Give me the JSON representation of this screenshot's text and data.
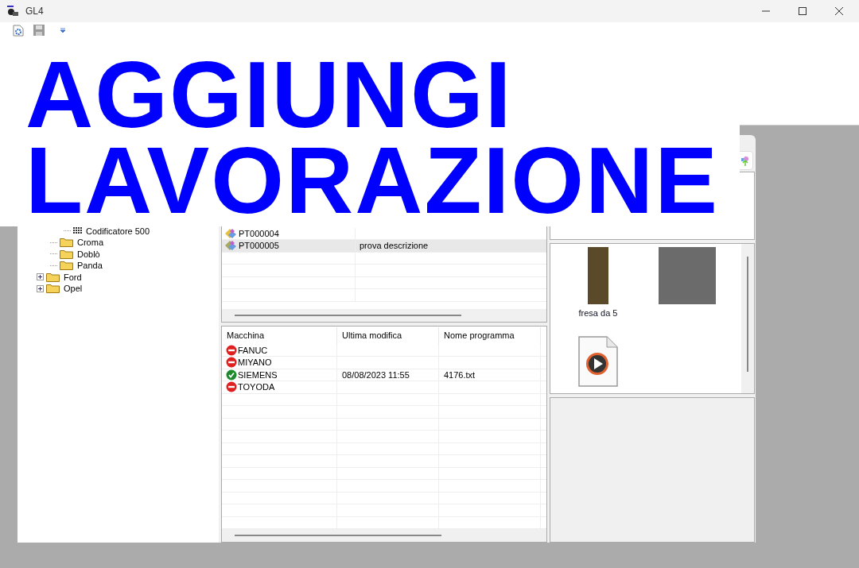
{
  "window": {
    "title": "GL4"
  },
  "banner": {
    "lines": [
      "AGGIUNGI",
      "LAVORAZIONE"
    ]
  },
  "tree": [
    {
      "children": [
        {
          "children": [
            {
              "label": "Codificatore 500",
              "kind": "encoder"
            }
          ]
        },
        {
          "label": "Croma",
          "kind": "folder"
        },
        {
          "label": "Doblò",
          "kind": "folder"
        },
        {
          "label": "Panda",
          "kind": "folder"
        }
      ]
    },
    {
      "label": "Ford",
      "kind": "folder",
      "expanded": false
    },
    {
      "label": "Opel",
      "kind": "folder",
      "expanded": false
    }
  ],
  "processes": {
    "rows": [
      {
        "code": "PT000004",
        "description": "",
        "selected": false
      },
      {
        "code": "PT000005",
        "description": "prova descrizione",
        "selected": true
      }
    ]
  },
  "machines": {
    "columns": [
      "Macchina",
      "Ultima modifica",
      "Nome programma"
    ],
    "rows": [
      {
        "name": "FANUC",
        "kind": "error",
        "modified": "",
        "program": ""
      },
      {
        "name": "MIYANO",
        "kind": "error",
        "modified": "",
        "program": ""
      },
      {
        "name": "SIEMENS",
        "kind": "ok",
        "modified": "08/08/2023 11:55",
        "program": "4176.txt"
      },
      {
        "name": "TOYODA",
        "kind": "error",
        "modified": "",
        "program": ""
      }
    ]
  },
  "attachments": [
    {
      "kind": "photo",
      "label": "fresa da 5"
    },
    {
      "kind": "photo"
    },
    {
      "kind": "video"
    }
  ]
}
